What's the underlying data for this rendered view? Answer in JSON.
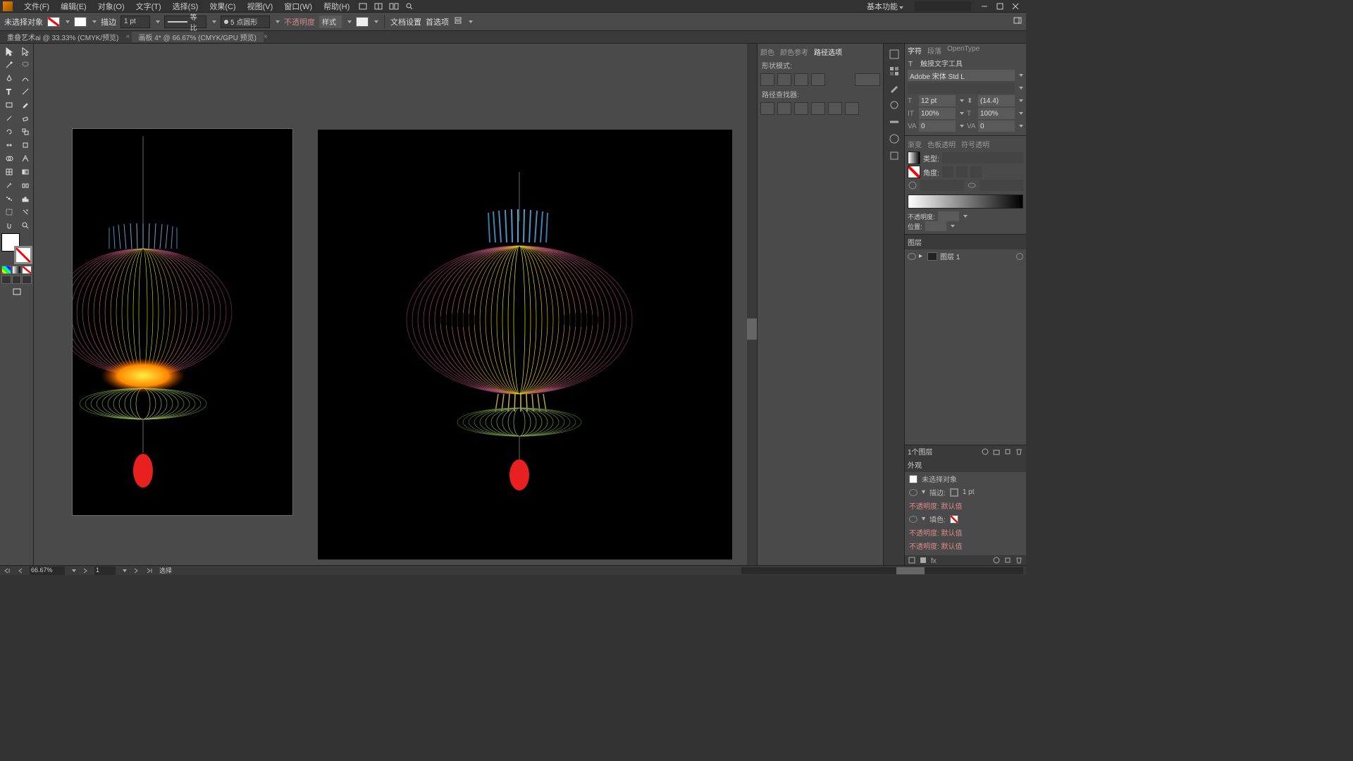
{
  "menu": {
    "file": "文件(F)",
    "edit": "编辑(E)",
    "object": "对象(O)",
    "type": "文字(T)",
    "select": "选择(S)",
    "effect": "效果(C)",
    "view": "视图(V)",
    "window": "窗口(W)",
    "help": "帮助(H)",
    "right_label": "基本功能"
  },
  "control": {
    "no_selection": "未选择对象",
    "stroke_label": "描边",
    "stroke_weight": "1 pt",
    "stroke_style": "等比",
    "stroke_profile": "5 点圆形",
    "opacity_label": "不透明度",
    "opacity_value": "样式",
    "doc_setup": "文档设置",
    "preferences": "首选项"
  },
  "tabs": {
    "tab1": "重叠艺术ai @ 33.33% (CMYK/预览)",
    "tab2": "画板 4* @ 66.67% (CMYK/GPU 预览)"
  },
  "mid_panel": {
    "tab_color": "颜色",
    "tab_color_guide": "颜色参考",
    "path_options": "路径选项",
    "mode_label": "形状模式:",
    "pathfinder": "路径查找器:"
  },
  "character": {
    "tab_char": "字符",
    "tab_para": "段落",
    "tab_ot": "OpenType",
    "touch_type": "触摸文字工具",
    "font": "Adobe 宋体 Std L",
    "size": "12 pt",
    "leading": "(14.4)",
    "tracking_v": "100%",
    "tracking_h": "100%",
    "kern": "0",
    "track": "0"
  },
  "gradient": {
    "tab_grad": "渐变",
    "tab_transp": "色板透明",
    "tab_sym": "符号透明",
    "type_label": "类型:",
    "angle_label": "角度:",
    "opacity_label": "不透明度:",
    "location_label": "位置:"
  },
  "layers": {
    "title_tab": "图层",
    "layer1": "图层 1",
    "count": "1个图层"
  },
  "appearance": {
    "title": "外观",
    "no_selection": "未选择对象",
    "stroke": "描边:",
    "stroke_val": "1 pt",
    "opacity_default": "不透明度: 默认值",
    "fill": "填色:",
    "opacity_default2": "不透明度: 默认值",
    "opacity_default3": "不透明度: 默认值"
  },
  "status": {
    "zoom": "66.67%",
    "artboard": "1",
    "tool": "选择"
  }
}
